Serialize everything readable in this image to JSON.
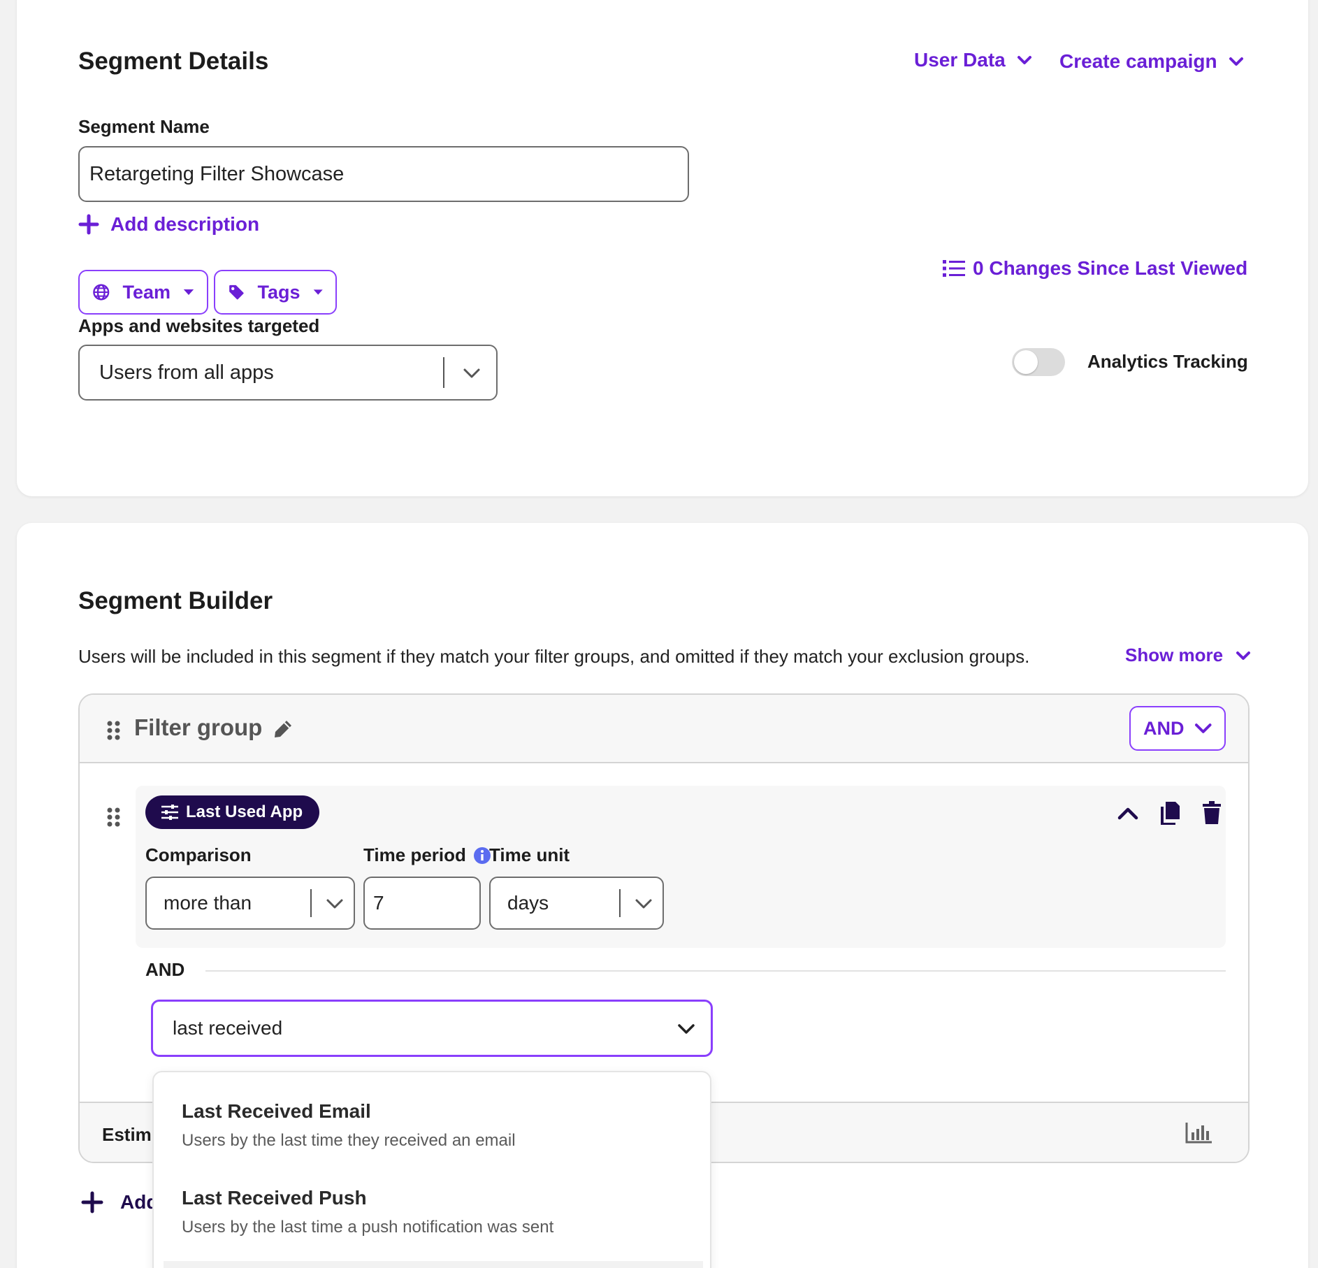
{
  "details": {
    "title": "Segment Details",
    "user_data_label": "User Data",
    "create_campaign_label": "Create campaign",
    "segment_name_label": "Segment Name",
    "segment_name_value": "Retargeting Filter Showcase",
    "add_description_label": "Add description",
    "team_label": "Team",
    "tags_label": "Tags",
    "changes_label": "0 Changes Since Last Viewed",
    "apps_label": "Apps and websites targeted",
    "apps_value": "Users from all apps",
    "analytics_label": "Analytics Tracking",
    "analytics_on": false
  },
  "builder": {
    "title": "Segment Builder",
    "description": "Users will be included in this segment if they match your filter groups, and omitted if they match your exclusion groups.",
    "show_more_label": "Show more",
    "filter_group": {
      "title": "Filter group",
      "operator": "AND",
      "filter": {
        "tag_label": "Last Used App",
        "comparison_label": "Comparison",
        "comparison_value": "more than",
        "time_period_label": "Time period",
        "time_period_value": "7",
        "time_unit_label": "Time unit",
        "time_unit_value": "days"
      },
      "and_label": "AND",
      "search_value": "last received",
      "estimate_label": "Estim"
    },
    "add_label": "Add",
    "dropdown_options": [
      {
        "title": "Last Received Email",
        "subtitle": "Users by the last time they received an email"
      },
      {
        "title": "Last Received Push",
        "subtitle": "Users by the last time a push notification was sent"
      }
    ]
  },
  "colors": {
    "accent": "#6a1fd6",
    "tag_bg": "#1f0b4d",
    "info_blue": "#5b6cf0"
  }
}
